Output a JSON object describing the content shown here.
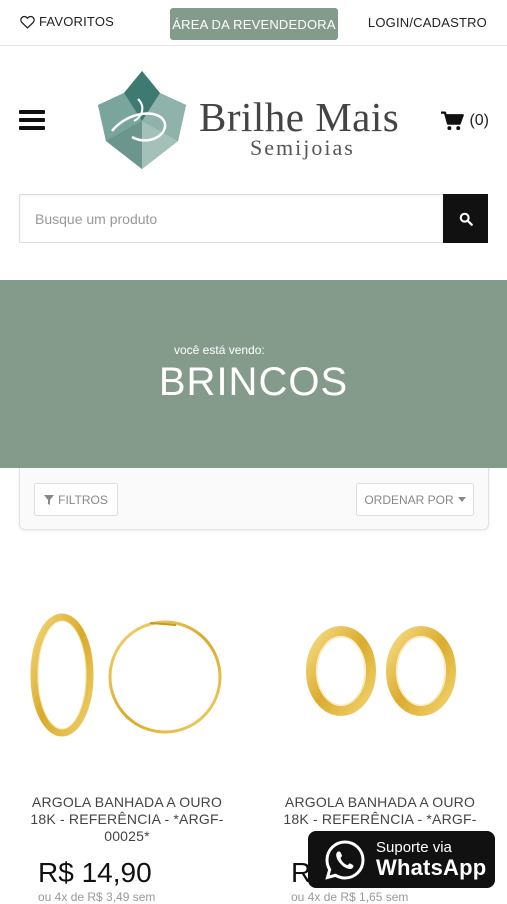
{
  "topbar": {
    "favorites_label": "FAVORITOS",
    "reseller_label": "ÁREA DA REVENDEDORA",
    "login_label": "LOGIN/CADASTRO"
  },
  "header": {
    "brand_name": "Brilhe Mais",
    "brand_sub": "Semijoias",
    "cart_count": "(0)"
  },
  "search": {
    "placeholder": "Busque um produto"
  },
  "banner": {
    "subtitle": "você está vendo:",
    "title": "BRINCOS"
  },
  "toolbar": {
    "filter_label": "FILTROS",
    "order_label": "ORDENAR POR"
  },
  "products": [
    {
      "name": "ARGOLA BANHADA A OURO 18K - REFERÊNCIA - *ARGF-00025*",
      "price": "R$ 14,90",
      "installment": "ou 4x de R$ 3,49 sem"
    },
    {
      "name": "ARGOLA BANHADA A OURO 18K - REFERÊNCIA - *ARGF-00026*",
      "price": "R$",
      "installment": "ou 4x de R$ 1,65 sem"
    }
  ],
  "whatsapp": {
    "line1": "Suporte via",
    "line2": "WhatsApp"
  },
  "colors": {
    "accent": "#849b8c",
    "dark": "#111111",
    "gold": "#e3b93a"
  }
}
